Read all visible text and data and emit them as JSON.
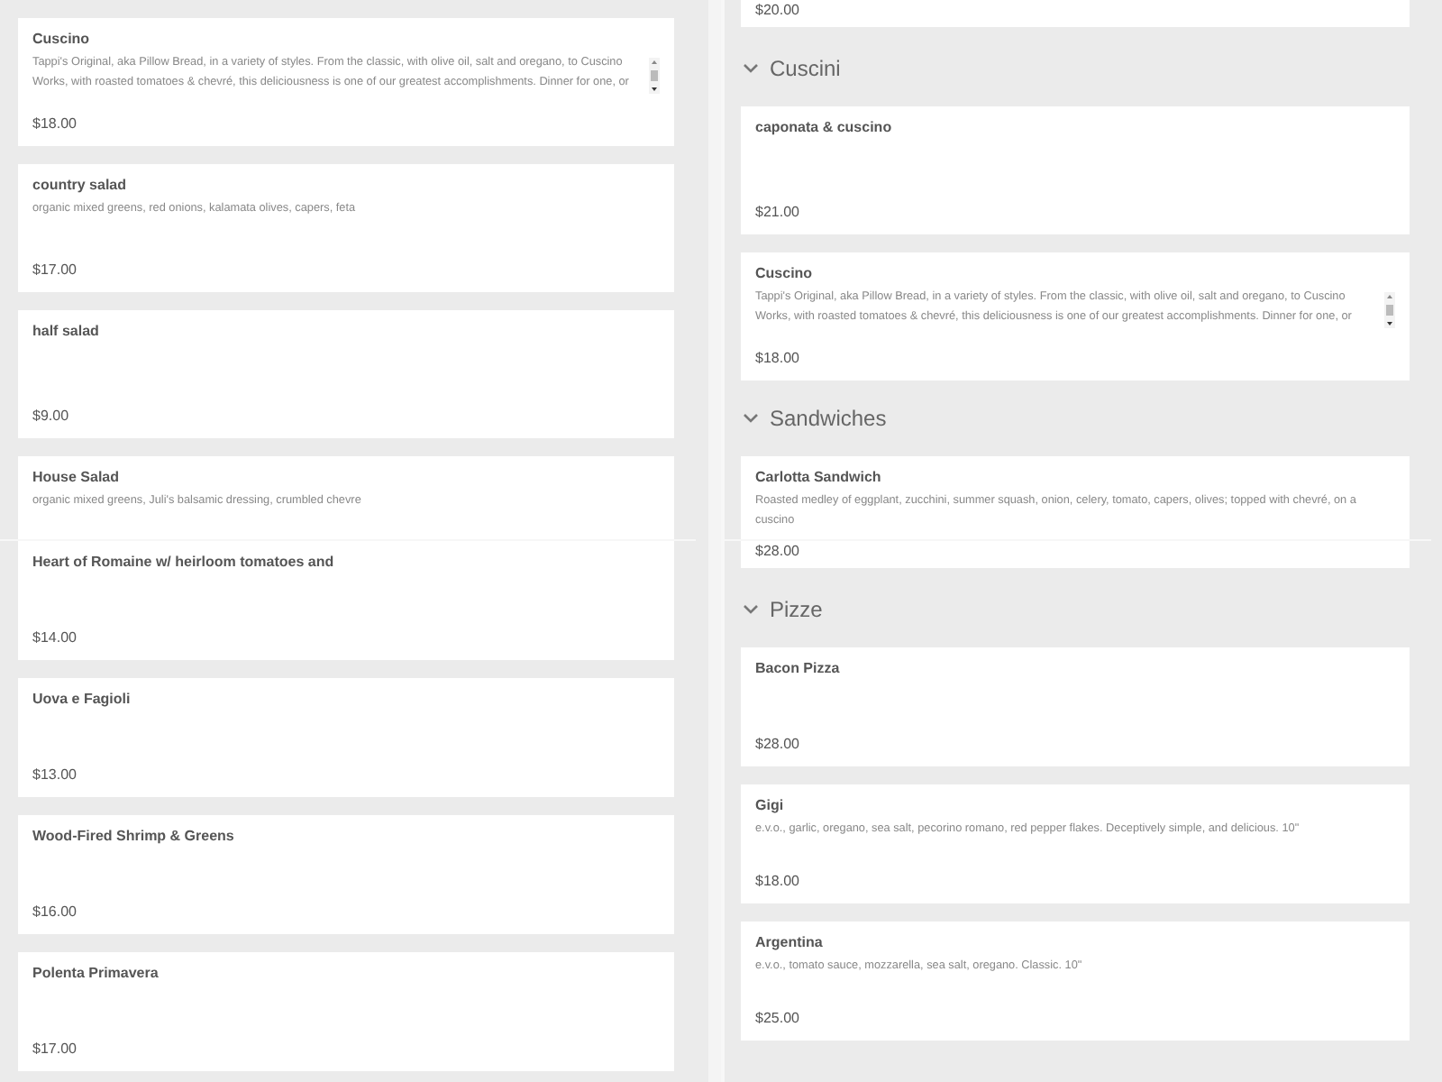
{
  "columns": [
    {
      "entries": [
        {
          "kind": "card",
          "title": "Cuscino",
          "description": "Tappi's Original, aka Pillow Bread, in a variety of styles. From the classic, with olive oil, salt and oregano, to Cuscino Works, with roasted tomatoes & chevré, this deliciousness is one of our greatest accomplishments. Dinner for one, or",
          "scrollable": true,
          "price": "$18.00"
        },
        {
          "kind": "card",
          "title": "country salad",
          "description": "organic mixed greens, red onions, kalamata olives, capers, feta",
          "price": "$17.00"
        },
        {
          "kind": "card",
          "title": "half salad",
          "price": "$9.00"
        },
        {
          "kind": "card",
          "title": "House Salad",
          "description": "organic mixed greens, Juli's balsamic dressing, crumbled chevre"
        },
        {
          "kind": "card",
          "title": "Heart of Romaine w/ heirloom tomatoes and",
          "price": "$14.00"
        },
        {
          "kind": "card",
          "title": "Uova e Fagioli",
          "price": "$13.00"
        },
        {
          "kind": "card",
          "title": "Wood-Fired Shrimp & Greens",
          "price": "$16.00"
        },
        {
          "kind": "card",
          "title": "Polenta Primavera",
          "price": "$17.00"
        }
      ]
    },
    {
      "entries": [
        {
          "kind": "card",
          "price": "$20.00"
        },
        {
          "kind": "section",
          "title": "Cuscini",
          "expanded": true
        },
        {
          "kind": "card",
          "title": "caponata & cuscino",
          "price": "$21.00"
        },
        {
          "kind": "card",
          "title": "Cuscino",
          "description": "Tappi's Original, aka Pillow Bread, in a variety of styles. From the classic, with olive oil, salt and oregano, to Cuscino Works, with roasted tomatoes & chevré, this deliciousness is one of our greatest accomplishments. Dinner for one, or",
          "scrollable": true,
          "price": "$18.00"
        },
        {
          "kind": "section",
          "title": "Sandwiches",
          "expanded": true
        },
        {
          "kind": "card",
          "title": "Carlotta Sandwich",
          "description": "Roasted medley of eggplant, zucchini, summer squash, onion, celery, tomato, capers, olives; topped with chevré, on a cuscino"
        },
        {
          "kind": "card",
          "price": "$28.00"
        },
        {
          "kind": "section",
          "title": "Pizze",
          "expanded": true
        },
        {
          "kind": "card",
          "title": "Bacon Pizza",
          "price": "$28.00"
        },
        {
          "kind": "card",
          "title": "Gigi",
          "description": "e.v.o., garlic, oregano, sea salt, pecorino romano, red pepper flakes. Deceptively simple, and delicious. 10\"",
          "price": "$18.00"
        },
        {
          "kind": "card",
          "title": "Argentina",
          "description": "e.v.o., tomato sauce, mozzarella, sea salt, oregano. Classic. 10\"",
          "price": "$25.00"
        }
      ]
    }
  ]
}
